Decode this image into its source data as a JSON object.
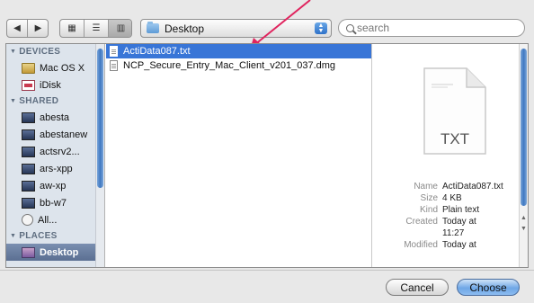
{
  "toolbar": {
    "back_icon": "◀",
    "forward_icon": "▶",
    "view_icons_icon": "▦",
    "view_list_icon": "☰",
    "view_columns_icon": "▥",
    "location": "Desktop",
    "search_placeholder": "search"
  },
  "sidebar": {
    "devices_label": "DEVICES",
    "devices": [
      {
        "label": "Mac OS X",
        "icon": "hard-drive-icon"
      },
      {
        "label": "iDisk",
        "icon": "idisk-icon"
      }
    ],
    "shared_label": "SHARED",
    "shared": [
      {
        "label": "abesta"
      },
      {
        "label": "abestanew"
      },
      {
        "label": "actsrv2..."
      },
      {
        "label": "ars-xpp"
      },
      {
        "label": "aw-xp"
      },
      {
        "label": "bb-w7"
      },
      {
        "label": "All..."
      }
    ],
    "places_label": "PLACES",
    "places": [
      {
        "label": "Desktop",
        "selected": true
      }
    ]
  },
  "files": [
    {
      "name": "ActiData087.txt",
      "selected": true
    },
    {
      "name": "NCP_Secure_Entry_Mac_Client_v201_037.dmg",
      "selected": false
    }
  ],
  "preview": {
    "type_label": "TXT",
    "name_key": "Name",
    "name_val": "ActiData087.txt",
    "size_key": "Size",
    "size_val": "4 KB",
    "kind_key": "Kind",
    "kind_val": "Plain text",
    "created_key": "Created",
    "created_val": "Today at",
    "created_time": "11:27",
    "modified_key": "Modified",
    "modified_val": "Today at"
  },
  "buttons": {
    "cancel": "Cancel",
    "choose": "Choose"
  },
  "colors": {
    "selection": "#3875d7",
    "sidebar_bg": "#dde4ec",
    "annotation_arrow": "#e0245e"
  }
}
